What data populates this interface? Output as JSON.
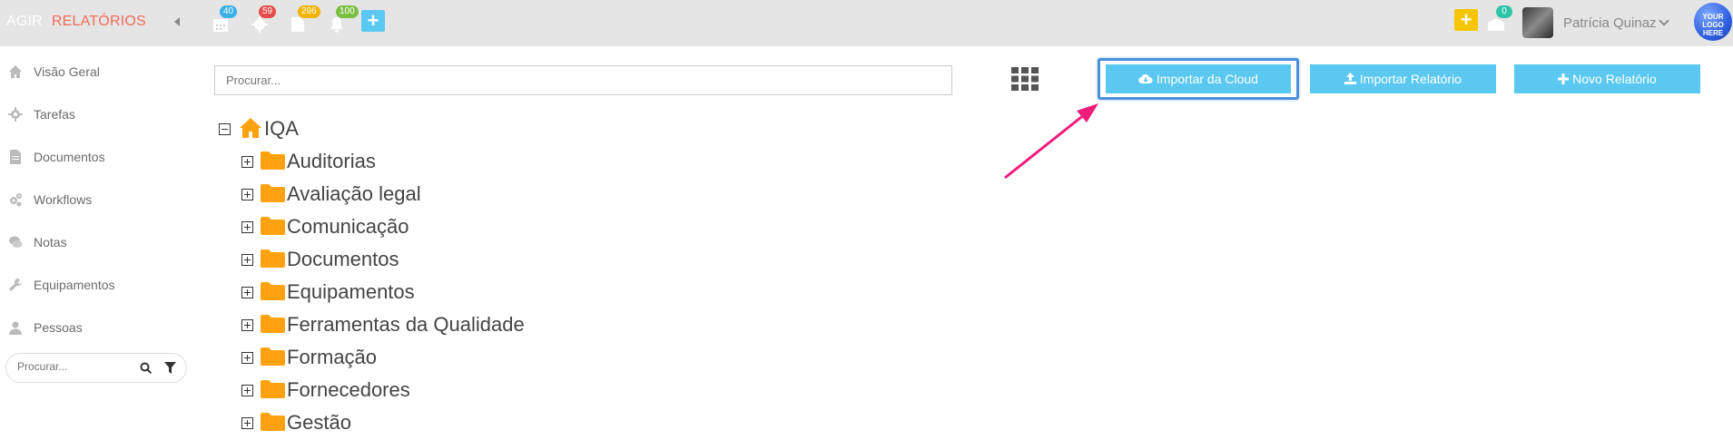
{
  "header": {
    "brand_part1": "AGIR",
    "brand_part2": "RELATÓRIOS",
    "badges": [
      {
        "icon": "calendar-icon",
        "count": "40",
        "color": "#3bb0e6"
      },
      {
        "icon": "gear-icon",
        "count": "59",
        "color": "#e94c4c"
      },
      {
        "icon": "document-icon",
        "count": "296",
        "color": "#f0b400"
      },
      {
        "icon": "bell-icon",
        "count": "100",
        "color": "#7cc043"
      }
    ],
    "inbox_count": "0",
    "user_name": "Patrícia Quinaz",
    "logo_text": "YOUR LOGO HERE"
  },
  "sidebar": {
    "items": [
      {
        "label": "Visão Geral",
        "icon": "home-icon"
      },
      {
        "label": "Tarefas",
        "icon": "gear-icon"
      },
      {
        "label": "Documentos",
        "icon": "document-icon"
      },
      {
        "label": "Workflows",
        "icon": "gears-icon"
      },
      {
        "label": "Notas",
        "icon": "chat-icon"
      },
      {
        "label": "Equipamentos",
        "icon": "wrench-icon"
      },
      {
        "label": "Pessoas",
        "icon": "person-icon"
      }
    ],
    "search_placeholder": "Procurar..."
  },
  "main": {
    "search_placeholder": "Procurar...",
    "buttons": {
      "import_cloud": "Importar da Cloud",
      "import_report": "Importar Relatório",
      "new_report": "Novo Relatório"
    },
    "tree": {
      "root": "IQA",
      "folders": [
        "Auditorias",
        "Avaliação legal",
        "Comunicação",
        "Documentos",
        "Equipamentos",
        "Ferramentas da Qualidade",
        "Formação",
        "Fornecedores",
        "Gestão"
      ]
    }
  },
  "colors": {
    "accent": "#5bc8f2",
    "brand_red": "#f26c5a",
    "folder": "#ffa20f",
    "highlight_arrow": "#ee1d7a"
  }
}
